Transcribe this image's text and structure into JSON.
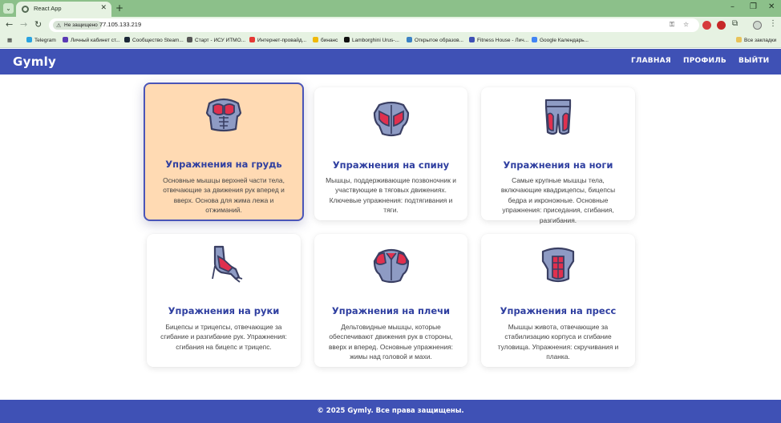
{
  "browser": {
    "tab_title": "React App",
    "security_label": "Не защищено",
    "url": "77.105.133.219",
    "bookmarks": [
      {
        "label": "Telegram",
        "color": "#2aa3e0"
      },
      {
        "label": "Личный кабинет ст...",
        "color": "#5b3bb5"
      },
      {
        "label": "Сообщество Steam...",
        "color": "#1b2838"
      },
      {
        "label": "Старт - ИСУ ИТМО...",
        "color": "#555555"
      },
      {
        "label": "Интернет-провайд...",
        "color": "#e53935"
      },
      {
        "label": "бинанс",
        "color": "#f0b90b"
      },
      {
        "label": "Lamborghini Urus-...",
        "color": "#111111"
      },
      {
        "label": "Открытое образов...",
        "color": "#3b82c4"
      },
      {
        "label": "Fitness House - Лич...",
        "color": "#3f51b5"
      },
      {
        "label": "Google Календарь...",
        "color": "#4285f4"
      }
    ],
    "all_bookmarks": "Все закладки"
  },
  "header": {
    "logo": "Gymly",
    "nav": {
      "home": "ГЛАВНАЯ",
      "profile": "ПРОФИЛЬ",
      "logout": "ВЫЙТИ"
    }
  },
  "cards": [
    {
      "title": "Упражнения на грудь",
      "desc": "Основные мышцы верхней части тела, отвечающие за движения рук вперед и вверх. Основа для жима лежа и отжиманий.",
      "icon": "chest-muscle-icon",
      "active": true
    },
    {
      "title": "Упражнения на спину",
      "desc": "Мышцы, поддерживающие позвоночник и участвующие в тяговых движениях. Ключевые упражнения: подтягивания и тяги.",
      "icon": "back-muscle-icon",
      "active": false
    },
    {
      "title": "Упражнения на ноги",
      "desc": "Самые крупные мышцы тела, включающие квадрицепсы, бицепсы бедра и икроножные. Основные упражнения: приседания, сгибания, разгибания.",
      "icon": "legs-muscle-icon",
      "active": false
    },
    {
      "title": "Упражнения на руки",
      "desc": "Бицепсы и трицепсы, отвечающие за сгибание и разгибание рук. Упражнения: сгибания на бицепс и трицепс.",
      "icon": "arm-muscle-icon",
      "active": false
    },
    {
      "title": "Упражнения на плечи",
      "desc": "Дельтовидные мышцы, которые обеспечивают движения рук в стороны, вверх и вперед. Основные упражнения: жимы над головой и махи.",
      "icon": "shoulder-muscle-icon",
      "active": false
    },
    {
      "title": "Упражнения на пресс",
      "desc": "Мышцы живота, отвечающие за стабилизацию корпуса и сгибание туловища. Упражнения: скручивания и планка.",
      "icon": "abs-muscle-icon",
      "active": false
    }
  ],
  "footer": {
    "text": "© 2025 Gymly. Все права защищены."
  },
  "colors": {
    "brand": "#3f51b5",
    "title": "#2f3fa0",
    "active_card": "#ffdab3",
    "muscle_highlight": "#e0304e",
    "body_fill": "#8e9bc4",
    "outline": "#3a3f63"
  }
}
